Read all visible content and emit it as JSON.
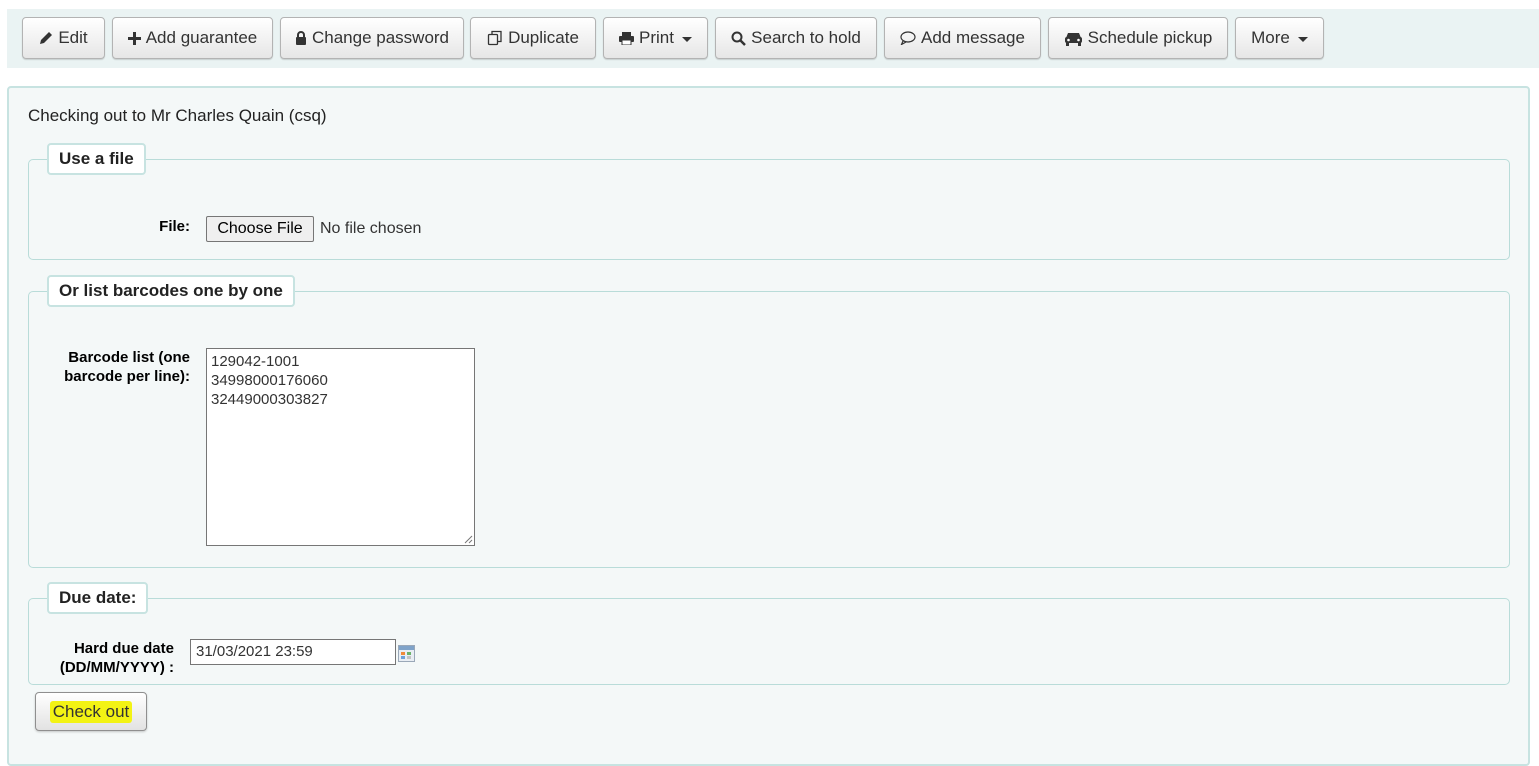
{
  "toolbar": {
    "edit": "Edit",
    "add_guarantee": "Add guarantee",
    "change_password": "Change password",
    "duplicate": "Duplicate",
    "print": "Print",
    "search_to_hold": "Search to hold",
    "add_message": "Add message",
    "schedule_pickup": "Schedule pickup",
    "more": "More"
  },
  "main": {
    "heading": "Checking out to Mr Charles Quain (csq)",
    "file_section": {
      "legend": "Use a file",
      "label": "File:",
      "choose_button": "Choose File",
      "status": "No file chosen"
    },
    "barcode_section": {
      "legend": "Or list barcodes one by one",
      "label_line1": "Barcode list (one",
      "label_line2": "barcode per line):",
      "barcodes": [
        "129042-1001",
        "34998000176060",
        "32449000303827"
      ]
    },
    "due_section": {
      "legend": "Due date:",
      "label_line1": "Hard due date",
      "label_line2": "(DD/MM/YYYY) :",
      "value": "31/03/2021 23:59"
    },
    "checkout_button": "Check out"
  },
  "colors": {
    "toolbar_bg": "#eaf3f3",
    "panel_border": "#c7e3e1",
    "highlight": "#f3f314"
  }
}
